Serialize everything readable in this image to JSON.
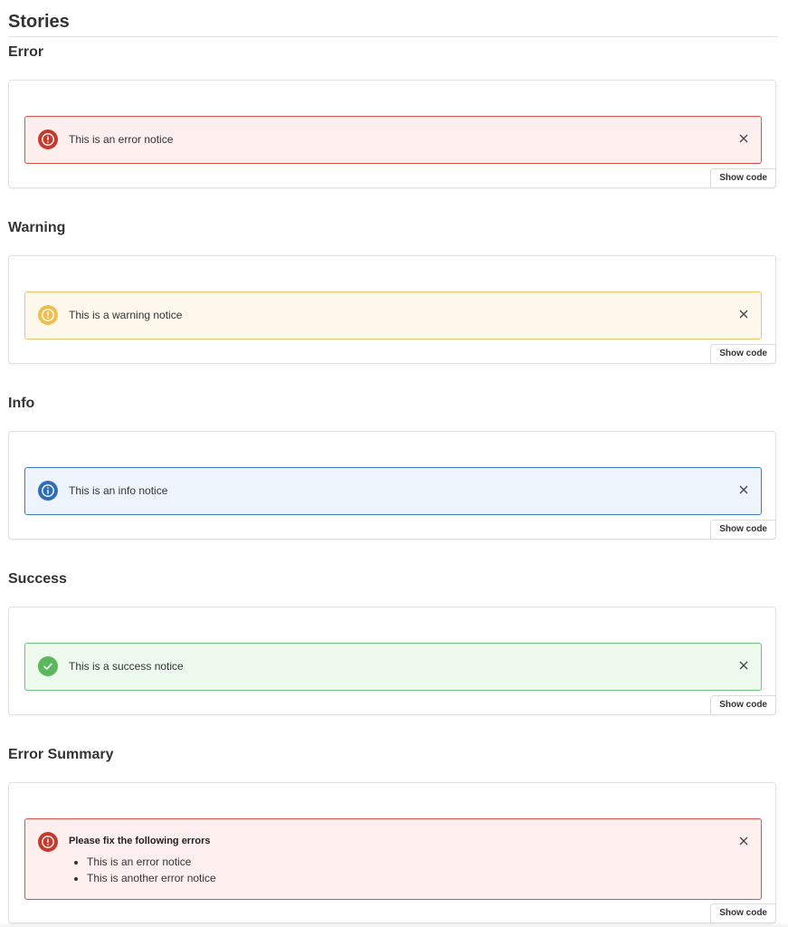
{
  "page": {
    "title": "Stories"
  },
  "colors": {
    "error_bg": "#fcefed",
    "error_border": "#d9534a",
    "error_icon": "#c63a2d",
    "warning_bg": "#fdf7ec",
    "warning_border": "#f1c56a",
    "warning_icon": "#f0c04f",
    "info_bg": "#eef4fb",
    "info_border": "#3d7cc0",
    "info_icon": "#2f6db5",
    "success_bg": "#eefaee",
    "success_border": "#6cc47a",
    "success_icon": "#5cb85c"
  },
  "stories": [
    {
      "heading": "Error",
      "notice_text": "This is an error notice",
      "icon": "exclamation-circle-icon",
      "show_code_label": "Show code"
    },
    {
      "heading": "Warning",
      "notice_text": "This is a warning notice",
      "icon": "exclamation-circle-icon",
      "show_code_label": "Show code"
    },
    {
      "heading": "Info",
      "notice_text": "This is an info notice",
      "icon": "info-circle-icon",
      "show_code_label": "Show code"
    },
    {
      "heading": "Success",
      "notice_text": "This is a success notice",
      "icon": "checkmark-circle-icon",
      "show_code_label": "Show code"
    },
    {
      "heading": "Error Summary",
      "summary_title": "Please fix the following errors",
      "items": [
        "This is an error notice",
        "This is another error notice"
      ],
      "icon": "exclamation-circle-icon",
      "show_code_label": "Show code"
    }
  ]
}
